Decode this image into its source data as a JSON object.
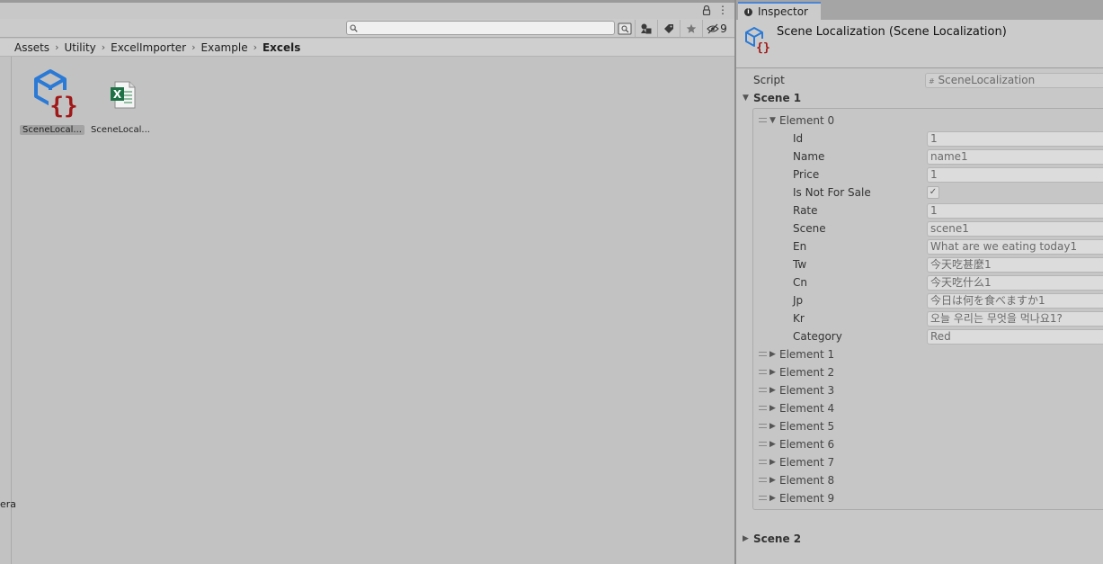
{
  "project": {
    "toolbar": {
      "menu_glyph": "⋮",
      "hidden_count": "9"
    },
    "search": {
      "value": "",
      "placeholder": ""
    },
    "breadcrumb": [
      "Assets",
      "Utility",
      "ExcelImporter",
      "Example",
      "Excels"
    ],
    "left_edge_text": "era",
    "assets": [
      {
        "label": "SceneLocal...",
        "icon": "scriptable-object-icon",
        "selected": true
      },
      {
        "label": "SceneLocal...",
        "icon": "excel-file-icon",
        "selected": false
      }
    ]
  },
  "inspector": {
    "tab_label": "Inspector",
    "title": "Scene Localization (Scene Localization)",
    "script": {
      "label": "Script",
      "value": "SceneLocalization"
    },
    "scene1": {
      "label": "Scene 1",
      "element0": {
        "label": "Element 0",
        "fields": [
          {
            "label": "Id",
            "value": "1"
          },
          {
            "label": "Name",
            "value": "name1"
          },
          {
            "label": "Price",
            "value": "1"
          },
          {
            "label": "Is Not For Sale",
            "value": "✓"
          },
          {
            "label": "Rate",
            "value": "1"
          },
          {
            "label": "Scene",
            "value": "scene1"
          },
          {
            "label": "En",
            "value": "What are we eating today1"
          },
          {
            "label": "Tw",
            "value": "今天吃甚麼1"
          },
          {
            "label": "Cn",
            "value": "今天吃什么1"
          },
          {
            "label": "Jp",
            "value": "今日は何を食べますか1"
          },
          {
            "label": "Kr",
            "value": "오늘 우리는 무엇을 먹나요1?"
          },
          {
            "label": "Category",
            "value": "Red"
          }
        ]
      },
      "collapsed_elements": [
        "Element 1",
        "Element 2",
        "Element 3",
        "Element 4",
        "Element 5",
        "Element 6",
        "Element 7",
        "Element 8",
        "Element 9"
      ]
    },
    "scene2": {
      "label": "Scene 2"
    }
  }
}
